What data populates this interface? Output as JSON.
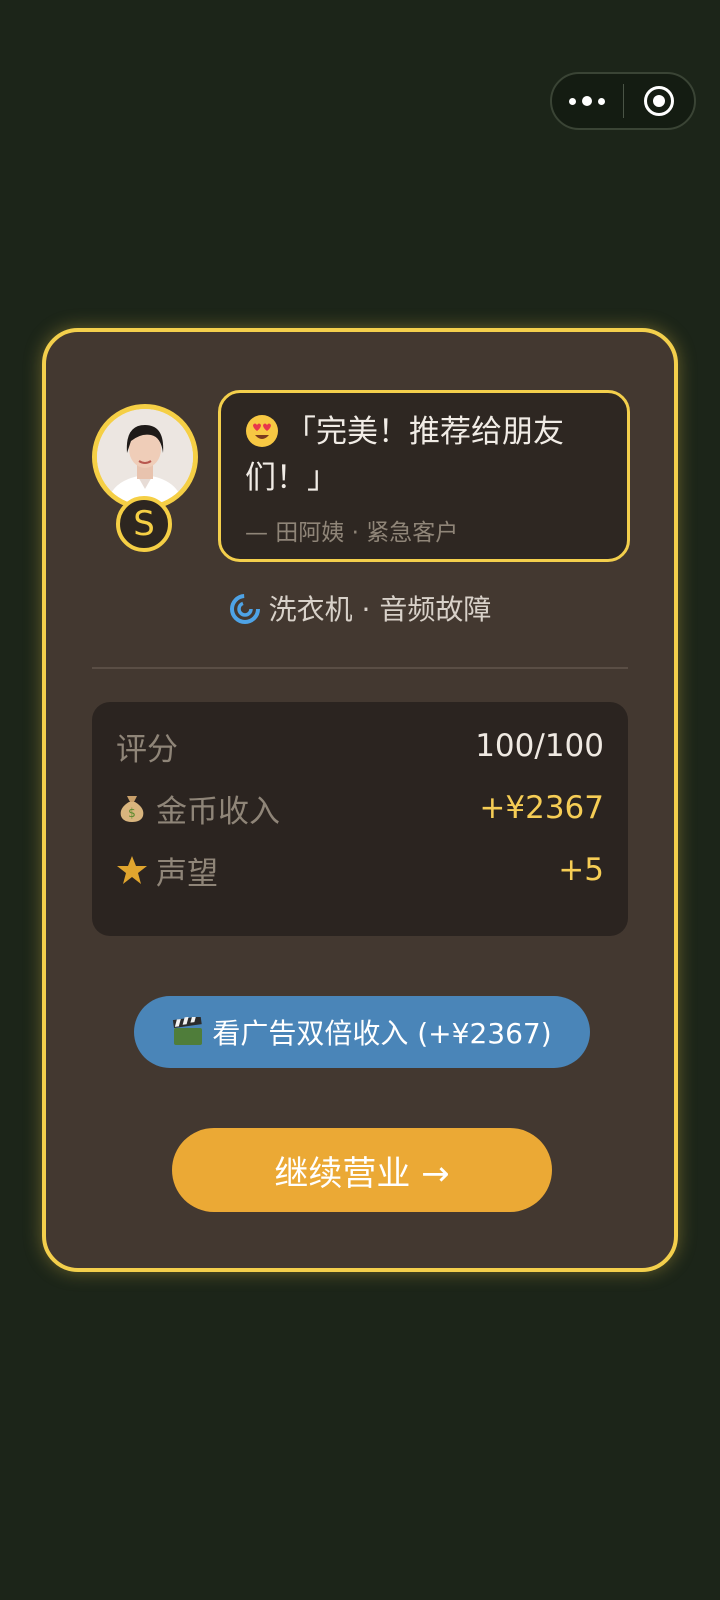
{
  "capsule": {
    "more_icon": "more-dots-icon",
    "close_icon": "target-close-icon"
  },
  "result": {
    "quote": "「完美！推荐给朋友们！」",
    "author": "— 田阿姨 · 紧急客户",
    "avatar_badge": "S",
    "device": "洗衣机 · 音频故障",
    "stats": [
      {
        "label": "评分",
        "value": "100/100",
        "icon": ""
      },
      {
        "label": "金币收入",
        "value": "+¥2367",
        "icon": "money-bag-icon"
      },
      {
        "label": "声望",
        "value": "+5",
        "icon": "star-icon"
      }
    ],
    "ad_button": "看广告双倍收入 (+¥2367)",
    "continue_button": "继续营业 →"
  },
  "colors": {
    "background": "#1c2519",
    "card": "#433830",
    "accent_gold": "#f3cf4c",
    "ad_blue": "#4a85b8",
    "continue_orange": "#eba935"
  }
}
